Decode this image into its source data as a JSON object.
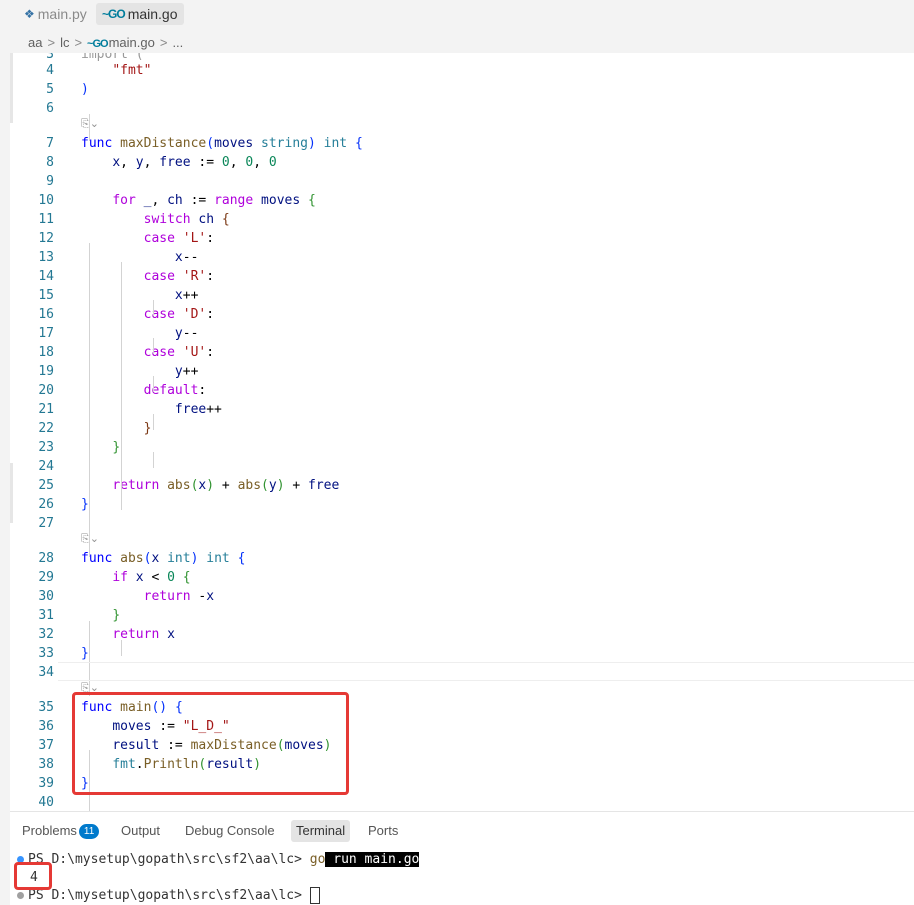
{
  "tabs": [
    {
      "label": "main.py",
      "icon": "python-icon",
      "active": false
    },
    {
      "label": "main.go",
      "icon": "go-icon",
      "active": true
    }
  ],
  "breadcrumb": {
    "part1": "aa",
    "part2": "lc",
    "file": "main.go",
    "more": "..."
  },
  "code_lines": [
    {
      "n": "4",
      "html": "    <span class='str'>\"fmt\"</span>"
    },
    {
      "n": "5",
      "html": "<span class='br1'>)</span>"
    },
    {
      "n": "6",
      "html": ""
    },
    {
      "n": "7",
      "html": "<span class='kw'>func</span> <span class='fn'>maxDistance</span><span class='br1'>(</span><span class='var'>moves</span> <span class='ty'>string</span><span class='br1'>)</span> <span class='ty'>int</span> <span class='br1'>{</span>"
    },
    {
      "n": "8",
      "html": "    <span class='var'>x</span>, <span class='var'>y</span>, <span class='var'>free</span> := <span class='num'>0</span>, <span class='num'>0</span>, <span class='num'>0</span>"
    },
    {
      "n": "9",
      "html": ""
    },
    {
      "n": "10",
      "html": "    <span class='ctl'>for</span> <span class='var'>_</span>, <span class='var'>ch</span> := <span class='ctl'>range</span> <span class='var'>moves</span> <span class='br2'>{</span>"
    },
    {
      "n": "11",
      "html": "        <span class='ctl'>switch</span> <span class='var'>ch</span> <span class='br3'>{</span>"
    },
    {
      "n": "12",
      "html": "        <span class='ctl'>case</span> <span class='str'>'L'</span>:"
    },
    {
      "n": "13",
      "html": "            <span class='var'>x</span>--"
    },
    {
      "n": "14",
      "html": "        <span class='ctl'>case</span> <span class='str'>'R'</span>:"
    },
    {
      "n": "15",
      "html": "            <span class='var'>x</span>++"
    },
    {
      "n": "16",
      "html": "        <span class='ctl'>case</span> <span class='str'>'D'</span>:"
    },
    {
      "n": "17",
      "html": "            <span class='var'>y</span>--"
    },
    {
      "n": "18",
      "html": "        <span class='ctl'>case</span> <span class='str'>'U'</span>:"
    },
    {
      "n": "19",
      "html": "            <span class='var'>y</span>++"
    },
    {
      "n": "20",
      "html": "        <span class='ctl'>default</span>:"
    },
    {
      "n": "21",
      "html": "            <span class='var'>free</span>++"
    },
    {
      "n": "22",
      "html": "        <span class='br3'>}</span>"
    },
    {
      "n": "23",
      "html": "    <span class='br2'>}</span>"
    },
    {
      "n": "24",
      "html": ""
    },
    {
      "n": "25",
      "html": "    <span class='ctl'>return</span> <span class='fn'>abs</span><span class='br2'>(</span><span class='var'>x</span><span class='br2'>)</span> + <span class='fn'>abs</span><span class='br2'>(</span><span class='var'>y</span><span class='br2'>)</span> + <span class='var'>free</span>"
    },
    {
      "n": "26",
      "html": "<span class='br1'>}</span>"
    },
    {
      "n": "27",
      "html": ""
    },
    {
      "n": "28",
      "html": "<span class='kw'>func</span> <span class='fn'>abs</span><span class='br1'>(</span><span class='var'>x</span> <span class='ty'>int</span><span class='br1'>)</span> <span class='ty'>int</span> <span class='br1'>{</span>"
    },
    {
      "n": "29",
      "html": "    <span class='ctl'>if</span> <span class='var'>x</span> &lt; <span class='num'>0</span> <span class='br2'>{</span>"
    },
    {
      "n": "30",
      "html": "        <span class='ctl'>return</span> -<span class='var'>x</span>"
    },
    {
      "n": "31",
      "html": "    <span class='br2'>}</span>"
    },
    {
      "n": "32",
      "html": "    <span class='ctl'>return</span> <span class='var'>x</span>"
    },
    {
      "n": "33",
      "html": "<span class='br1'>}</span>"
    },
    {
      "n": "34",
      "html": ""
    },
    {
      "n": "35",
      "html": "<span class='kw'>func</span> <span class='fn'>main</span><span class='br1'>()</span> <span class='br1'>{</span>"
    },
    {
      "n": "36",
      "html": "    <span class='var'>moves</span> := <span class='str'>\"L_D_\"</span>"
    },
    {
      "n": "37",
      "html": "    <span class='var'>result</span> := <span class='fn'>maxDistance</span><span class='br2'>(</span><span class='var'>moves</span><span class='br2'>)</span>"
    },
    {
      "n": "38",
      "html": "    <span class='ty'>fmt</span>.<span class='fn'>Println</span><span class='br2'>(</span><span class='var'>result</span><span class='br2'>)</span>"
    },
    {
      "n": "39",
      "html": "<span class='br1'>}</span>"
    },
    {
      "n": "40",
      "html": ""
    }
  ],
  "panel_tabs": [
    {
      "label": "Problems",
      "badge": "11",
      "active": false
    },
    {
      "label": "Output",
      "active": false
    },
    {
      "label": "Debug Console",
      "active": false
    },
    {
      "label": "Terminal",
      "active": true
    },
    {
      "label": "Ports",
      "active": false
    }
  ],
  "terminal": {
    "prompt1": "PS D:\\mysetup\\gopath\\src\\sf2\\aa\\lc> ",
    "cmd_go": "go",
    "cmd_rest": " run main.go",
    "output": "4",
    "prompt2": "PS D:\\mysetup\\gopath\\src\\sf2\\aa\\lc> "
  },
  "colors": {
    "highlight_box": "#e53935",
    "dot_info": "#3794ff",
    "dot_muted": "#a0a0a0"
  }
}
